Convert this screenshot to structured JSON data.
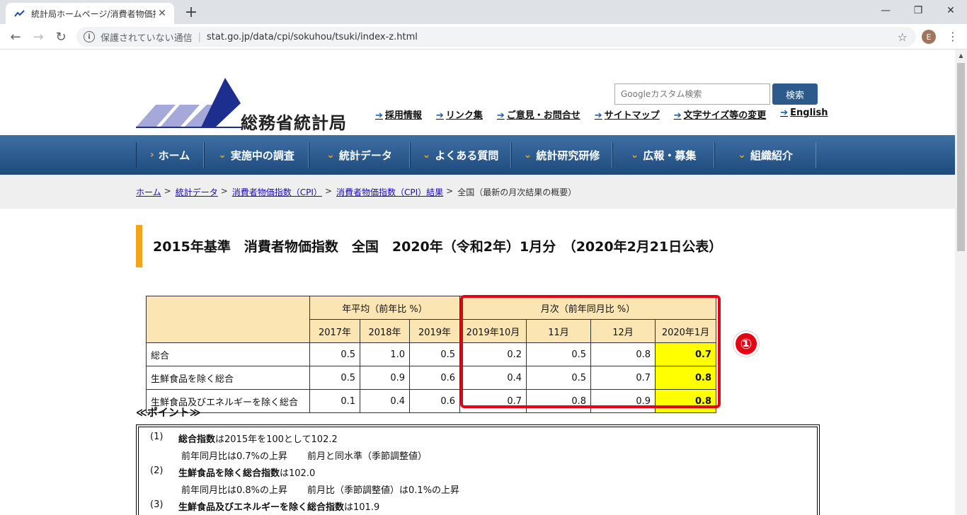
{
  "browser": {
    "tab_title": "統計局ホームページ/消費者物価指数",
    "security_label": "保護されていない通信",
    "url": "stat.go.jp/data/cpi/sokuhou/tsuki/index-z.html",
    "profile_initial": "E"
  },
  "header": {
    "logo_text": "総務省統計局",
    "search_placeholder": "Googleカスタム検索",
    "search_button": "検索",
    "util_links": [
      "採用情報",
      "リンク集",
      "ご意見・お問合せ",
      "サイトマップ",
      "文字サイズ等の変更",
      "English"
    ]
  },
  "nav": {
    "items": [
      "ホーム",
      "実施中の調査",
      "統計データ",
      "よくある質問",
      "統計研究研修",
      "広報・募集",
      "組織紹介"
    ]
  },
  "breadcrumb": {
    "items": [
      "ホーム",
      "統計データ",
      "消費者物価指数（CPI）",
      "消費者物価指数（CPI）結果"
    ],
    "current": "全国（最新の月次結果の概要）"
  },
  "page_title": "2015年基準　消費者物価指数　全国　2020年（令和2年）1月分　（2020年2月21日公表）",
  "table": {
    "group_annual": "年平均（前年比 %）",
    "group_monthly": "月次（前年同月比 %）",
    "columns": [
      "2017年",
      "2018年",
      "2019年",
      "2019年10月",
      "11月",
      "12月",
      "2020年1月"
    ],
    "rows": [
      {
        "label": "総合",
        "values": [
          "0.5",
          "1.0",
          "0.5",
          "0.2",
          "0.5",
          "0.8",
          "0.7"
        ]
      },
      {
        "label": "生鮮食品を除く総合",
        "values": [
          "0.5",
          "0.9",
          "0.6",
          "0.4",
          "0.5",
          "0.7",
          "0.8"
        ]
      },
      {
        "label": "生鮮食品及びエネルギーを除く総合",
        "values": [
          "0.1",
          "0.4",
          "0.6",
          "0.7",
          "0.8",
          "0.9",
          "0.8"
        ]
      }
    ]
  },
  "annotation_badge": "①",
  "points": {
    "title": "≪ポイント≫",
    "items": [
      {
        "no": "(1)",
        "bold": "総合指数",
        "rest": "は2015年を100として102.2",
        "subs": [
          "前年同月比は0.7%の上昇",
          "前月と同水準（季節調整値）"
        ]
      },
      {
        "no": "(2)",
        "bold": "生鮮食品を除く総合指数",
        "rest": "は102.0",
        "subs": [
          "前年同月比は0.8%の上昇",
          "前月比（季節調整値）は0.1%の上昇"
        ]
      },
      {
        "no": "(3)",
        "bold": "生鮮食品及びエネルギーを除く総合指数",
        "rest": "は101.9",
        "subs": []
      }
    ]
  }
}
